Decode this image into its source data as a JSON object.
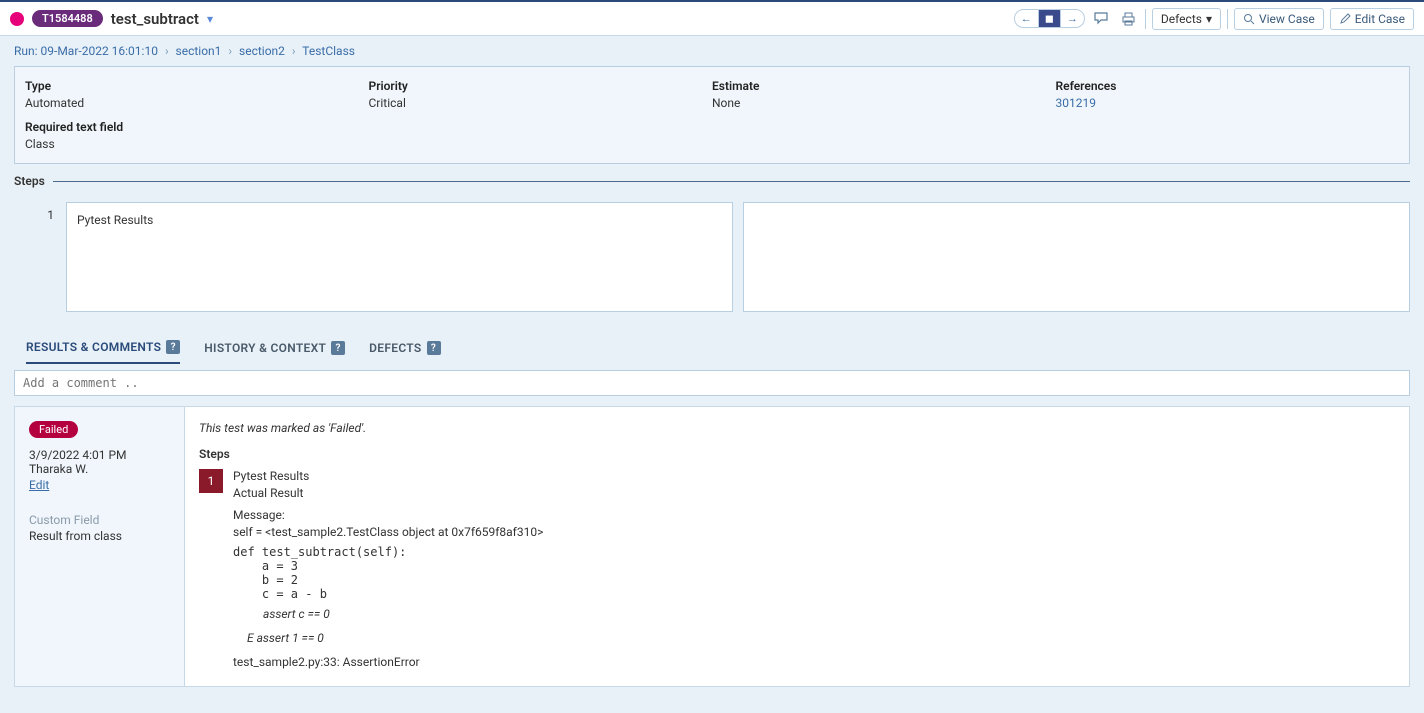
{
  "header": {
    "tag": "T1584488",
    "title": "test_subtract",
    "defects_dd": "Defects",
    "view_case": "View Case",
    "edit_case": "Edit Case"
  },
  "breadcrumbs": {
    "run": "Run: 09-Mar-2022 16:01:10",
    "sec1": "section1",
    "sec2": "section2",
    "cls": "TestClass"
  },
  "info": {
    "type_l": "Type",
    "type_v": "Automated",
    "prio_l": "Priority",
    "prio_v": "Critical",
    "est_l": "Estimate",
    "est_v": "None",
    "ref_l": "References",
    "ref_v": "301219",
    "req_l": "Required text field",
    "req_v": "Class"
  },
  "steps": {
    "heading": "Steps",
    "num": "1",
    "step1": "Pytest Results"
  },
  "tabs": {
    "t1": "RESULTS & COMMENTS",
    "t2": "HISTORY & CONTEXT",
    "t3": "DEFECTS"
  },
  "comment_ph": "Add a comment ..",
  "result": {
    "status": "Failed",
    "meta": "3/9/2022 4:01 PM Tharaka W.",
    "edit": "Edit",
    "custom_l": "Custom Field",
    "custom_v": "Result from class",
    "marked": "This test was marked as 'Failed'.",
    "steps_l": "Steps",
    "snum": "1",
    "sline1": "Pytest Results",
    "sline2": "Actual Result",
    "msg_l": "Message:",
    "msg1": "self = <test_sample2.TestClass object at 0x7f659f8af310>",
    "code": "def test_subtract(self):\n    a = 3\n    b = 2\n    c = a - b",
    "assert": "assert c == 0",
    "eassert": "E assert 1 == 0",
    "err": "test_sample2.py:33: AssertionError"
  }
}
